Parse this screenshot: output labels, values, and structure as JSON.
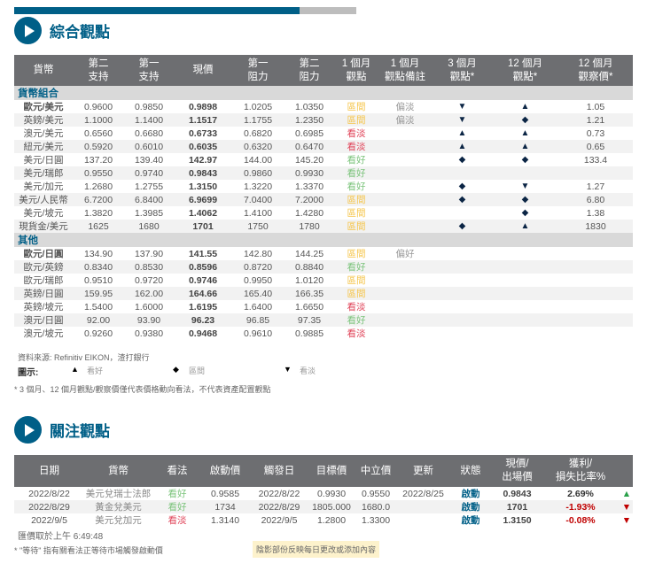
{
  "colors": {
    "brand": "#005f87",
    "header": "#6d6e71",
    "range": "#f5c54a",
    "bullish": "#7cc47c",
    "bearish": "#e0455a"
  },
  "section1": {
    "title": "綜合觀點",
    "icon": "play-circle-icon"
  },
  "overview": {
    "headers": [
      "貨幣",
      "第二\n支持",
      "第一\n支持",
      "現價",
      "第一\n阻力",
      "第二\n阻力",
      "1 個月\n觀點",
      "1 個月\n觀點備註",
      "3 個月\n觀點*",
      "12 個月\n觀點*",
      "12 個月\n觀察價*"
    ],
    "groups": [
      {
        "name": "貨幣組合",
        "rows": [
          [
            "歐元/美元",
            "0.9600",
            "0.9850",
            "0.9898",
            "1.0205",
            "1.0350",
            "區間",
            "偏淡",
            "down",
            "up",
            "1.05"
          ],
          [
            "英鎊/美元",
            "1.1000",
            "1.1400",
            "1.1517",
            "1.1755",
            "1.2350",
            "區間",
            "偏淡",
            "down",
            "diamond",
            "1.21"
          ],
          [
            "澳元/美元",
            "0.6560",
            "0.6680",
            "0.6733",
            "0.6820",
            "0.6985",
            "看淡",
            "",
            "up",
            "up",
            "0.73"
          ],
          [
            "紐元/美元",
            "0.5920",
            "0.6010",
            "0.6035",
            "0.6320",
            "0.6470",
            "看淡",
            "",
            "up",
            "up",
            "0.65"
          ],
          [
            "美元/日圓",
            "137.20",
            "139.40",
            "142.97",
            "144.00",
            "145.20",
            "看好",
            "",
            "diamond",
            "diamond",
            "133.4"
          ],
          [
            "美元/瑞郎",
            "0.9550",
            "0.9740",
            "0.9843",
            "0.9860",
            "0.9930",
            "看好",
            "",
            "",
            "",
            ""
          ],
          [
            "美元/加元",
            "1.2680",
            "1.2755",
            "1.3150",
            "1.3220",
            "1.3370",
            "看好",
            "",
            "diamond",
            "down",
            "1.27"
          ],
          [
            "美元/人民幣",
            "6.7200",
            "6.8400",
            "6.9699",
            "7.0400",
            "7.2000",
            "區間",
            "",
            "diamond",
            "diamond",
            "6.80"
          ],
          [
            "美元/坡元",
            "1.3820",
            "1.3985",
            "1.4062",
            "1.4100",
            "1.4280",
            "區間",
            "",
            "",
            "diamond",
            "1.38"
          ],
          [
            "現貨金/美元",
            "1625",
            "1680",
            "1701",
            "1750",
            "1780",
            "區間",
            "",
            "diamond",
            "up",
            "1830"
          ]
        ]
      },
      {
        "name": "其他",
        "rows": [
          [
            "歐元/日圓",
            "134.90",
            "137.90",
            "141.55",
            "142.80",
            "144.25",
            "區間",
            "偏好",
            "",
            "",
            ""
          ],
          [
            "歐元/英鎊",
            "0.8340",
            "0.8530",
            "0.8596",
            "0.8720",
            "0.8840",
            "看好",
            "",
            "",
            "",
            ""
          ],
          [
            "歐元/瑞郎",
            "0.9510",
            "0.9720",
            "0.9746",
            "0.9950",
            "1.0120",
            "區間",
            "",
            "",
            "",
            ""
          ],
          [
            "英鎊/日圓",
            "159.95",
            "162.00",
            "164.66",
            "165.40",
            "166.35",
            "區間",
            "",
            "",
            "",
            ""
          ],
          [
            "英鎊/坡元",
            "1.5400",
            "1.6000",
            "1.6195",
            "1.6400",
            "1.6650",
            "看淡",
            "",
            "",
            "",
            ""
          ],
          [
            "澳元/日圓",
            "92.00",
            "93.90",
            "96.23",
            "96.85",
            "97.35",
            "看好",
            "",
            "",
            "",
            ""
          ],
          [
            "澳元/坡元",
            "0.9260",
            "0.9380",
            "0.9468",
            "0.9610",
            "0.9885",
            "看淡",
            "",
            "",
            "",
            ""
          ]
        ]
      }
    ],
    "source": "資料來源: Refinitiv EIKON，渣打銀行",
    "legend": {
      "label": "圖示:",
      "items": [
        {
          "icon": "up",
          "text": "看好"
        },
        {
          "icon": "diamond",
          "text": "區間"
        },
        {
          "icon": "down",
          "text": "看淡"
        }
      ]
    },
    "note": "* 3 個月、12 個月觀點/觀察價僅代表價格動向看法，不代表資產配置觀點"
  },
  "section2": {
    "title": "關注觀點",
    "icon": "play-circle-icon"
  },
  "watch": {
    "headers": [
      "日期",
      "貨幣",
      "看法",
      "啟動價",
      "觸發日",
      "目標價",
      "中立價",
      "更新",
      "狀態",
      "現價/\n出場價",
      "獲利/\n損失比率%",
      ""
    ],
    "rows": [
      [
        "2022/8/22",
        "美元兌瑞士法郎",
        "看好",
        "0.9585",
        "2022/8/22",
        "0.9930",
        "0.9550",
        "2022/8/25",
        "啟動",
        "0.9843",
        "2.69%",
        "up"
      ],
      [
        "2022/8/29",
        "黃金兌美元",
        "看好",
        "1734",
        "2022/8/29",
        "1805.000",
        "1680.0",
        "",
        "啟動",
        "1701",
        "-1.93%",
        "down"
      ],
      [
        "2022/9/5",
        "美元兌加元",
        "看淡",
        "1.3140",
        "2022/9/5",
        "1.2800",
        "1.3300",
        "",
        "啟動",
        "1.3150",
        "-0.08%",
        "down"
      ]
    ],
    "timestamp": "匯價取於上午 6:49:48",
    "note": "* \"等待\" 指有關看法正等待市場觸發啟動價",
    "highlight": "陰影部份反映每日更改或添加內容"
  }
}
